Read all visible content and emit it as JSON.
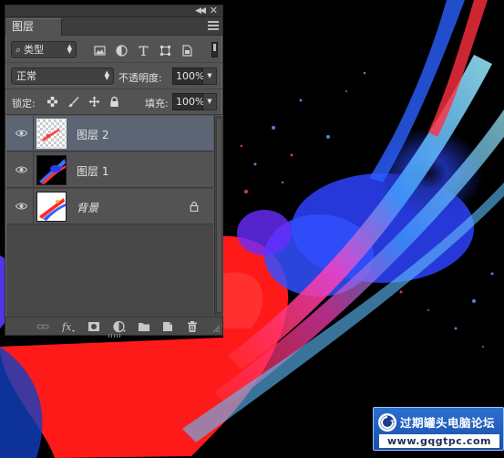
{
  "panel": {
    "tab_label": "图层",
    "filter": {
      "kind_label": "类型",
      "search_symbol": "⌕"
    },
    "blend_mode": "正常",
    "opacity_label": "不透明度:",
    "opacity_value": "100%",
    "lock_label": "锁定:",
    "fill_label": "填充:",
    "fill_value": "100%",
    "layers": [
      {
        "name": "图层 2",
        "selected": true,
        "visible": true,
        "locked": false
      },
      {
        "name": "图层 1",
        "selected": false,
        "visible": true,
        "locked": false
      },
      {
        "name": "背景",
        "selected": false,
        "visible": true,
        "locked": true
      }
    ]
  },
  "icons": {
    "top_bar": [
      "collapse-icon",
      "close-icon",
      "panel-menu-icon"
    ],
    "filter": [
      "pixel-layer-filter-icon",
      "adjustment-layer-filter-icon",
      "type-layer-filter-icon",
      "shape-layer-filter-icon",
      "smart-object-filter-icon"
    ],
    "lock": [
      "lock-transparent-pixels-icon",
      "lock-image-pixels-icon",
      "lock-position-icon",
      "lock-all-icon"
    ],
    "bottom_bar": [
      "link-layers-icon",
      "layer-style-icon",
      "add-mask-icon",
      "new-adjustment-layer-icon",
      "new-group-icon",
      "new-layer-icon",
      "delete-layer-icon"
    ]
  },
  "watermark": {
    "title": "过期罐头电脑论坛",
    "url": "www.gqgtpc.com"
  },
  "colors": {
    "panel_bg": "#535353",
    "selected_layer": "#5b6573",
    "watermark_blue": "#2b6fd0"
  }
}
